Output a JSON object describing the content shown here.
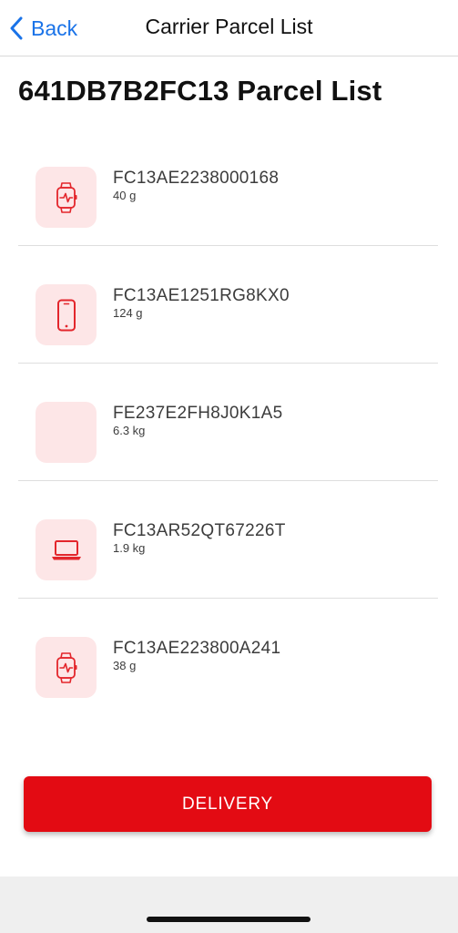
{
  "colors": {
    "accent": "#1a73e8",
    "brand_red": "#e30b13",
    "icon_tile_bg": "#fde6e7",
    "icon_red": "#e3262c"
  },
  "navbar": {
    "back_label": "Back",
    "back_icon": "chevron-left-icon",
    "title": "Carrier Parcel List"
  },
  "page": {
    "title": "641DB7B2FC13 Parcel List"
  },
  "parcels": [
    {
      "code": "FC13AE2238000168",
      "weight": "40 g",
      "icon": "smartwatch-icon"
    },
    {
      "code": "FC13AE1251RG8KX0",
      "weight": "124 g",
      "icon": "smartphone-icon"
    },
    {
      "code": "FE237E2FH8J0K1A5",
      "weight": "6.3 kg",
      "icon": ""
    },
    {
      "code": "FC13AR52QT67226T",
      "weight": "1.9 kg",
      "icon": "laptop-icon"
    },
    {
      "code": "FC13AE223800A241",
      "weight": "38 g",
      "icon": "smartwatch-icon"
    }
  ],
  "actions": {
    "delivery_label": "DELIVERY"
  }
}
